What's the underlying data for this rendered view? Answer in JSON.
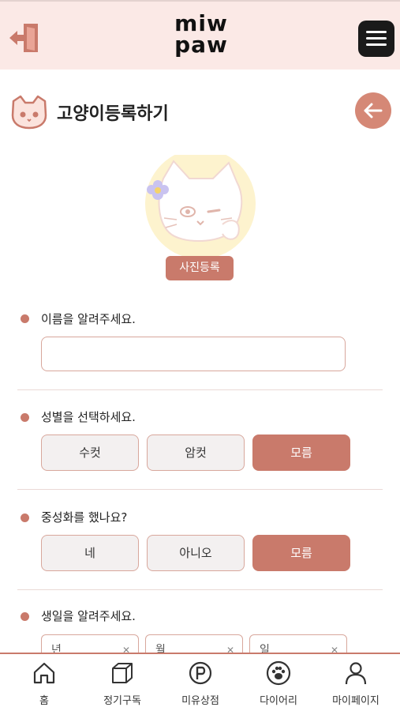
{
  "header": {
    "logo_line1": "miw",
    "logo_line2": "paw",
    "exit_icon": "exit-door-icon",
    "menu_icon": "hamburger-menu-icon"
  },
  "page": {
    "title": "고양이등록하기",
    "back_icon": "arrow-left-icon"
  },
  "photo": {
    "button_label": "사진등록"
  },
  "form": {
    "name": {
      "label": "이름을 알려주세요.",
      "value": "",
      "placeholder": ""
    },
    "gender": {
      "label": "성별을 선택하세요.",
      "options": [
        "수컷",
        "암컷",
        "모름"
      ],
      "selected": "모름"
    },
    "neutered": {
      "label": "중성화를 했나요?",
      "options": [
        "네",
        "아니오",
        "모름"
      ],
      "selected": "모름"
    },
    "birthday": {
      "label": "생일을 알려주세요.",
      "fields": [
        "년",
        "월",
        "일"
      ]
    }
  },
  "nav": {
    "items": [
      {
        "label": "홈",
        "icon": "home-icon"
      },
      {
        "label": "정기구독",
        "icon": "box-icon"
      },
      {
        "label": "미유상점",
        "icon": "p-coin-icon"
      },
      {
        "label": "다이어리",
        "icon": "paw-icon"
      },
      {
        "label": "마이페이지",
        "icon": "user-icon"
      }
    ]
  },
  "colors": {
    "accent": "#c97a6b",
    "header_bg": "#fbe9e6",
    "border": "#d8a79c",
    "back_button": "#d58876"
  }
}
